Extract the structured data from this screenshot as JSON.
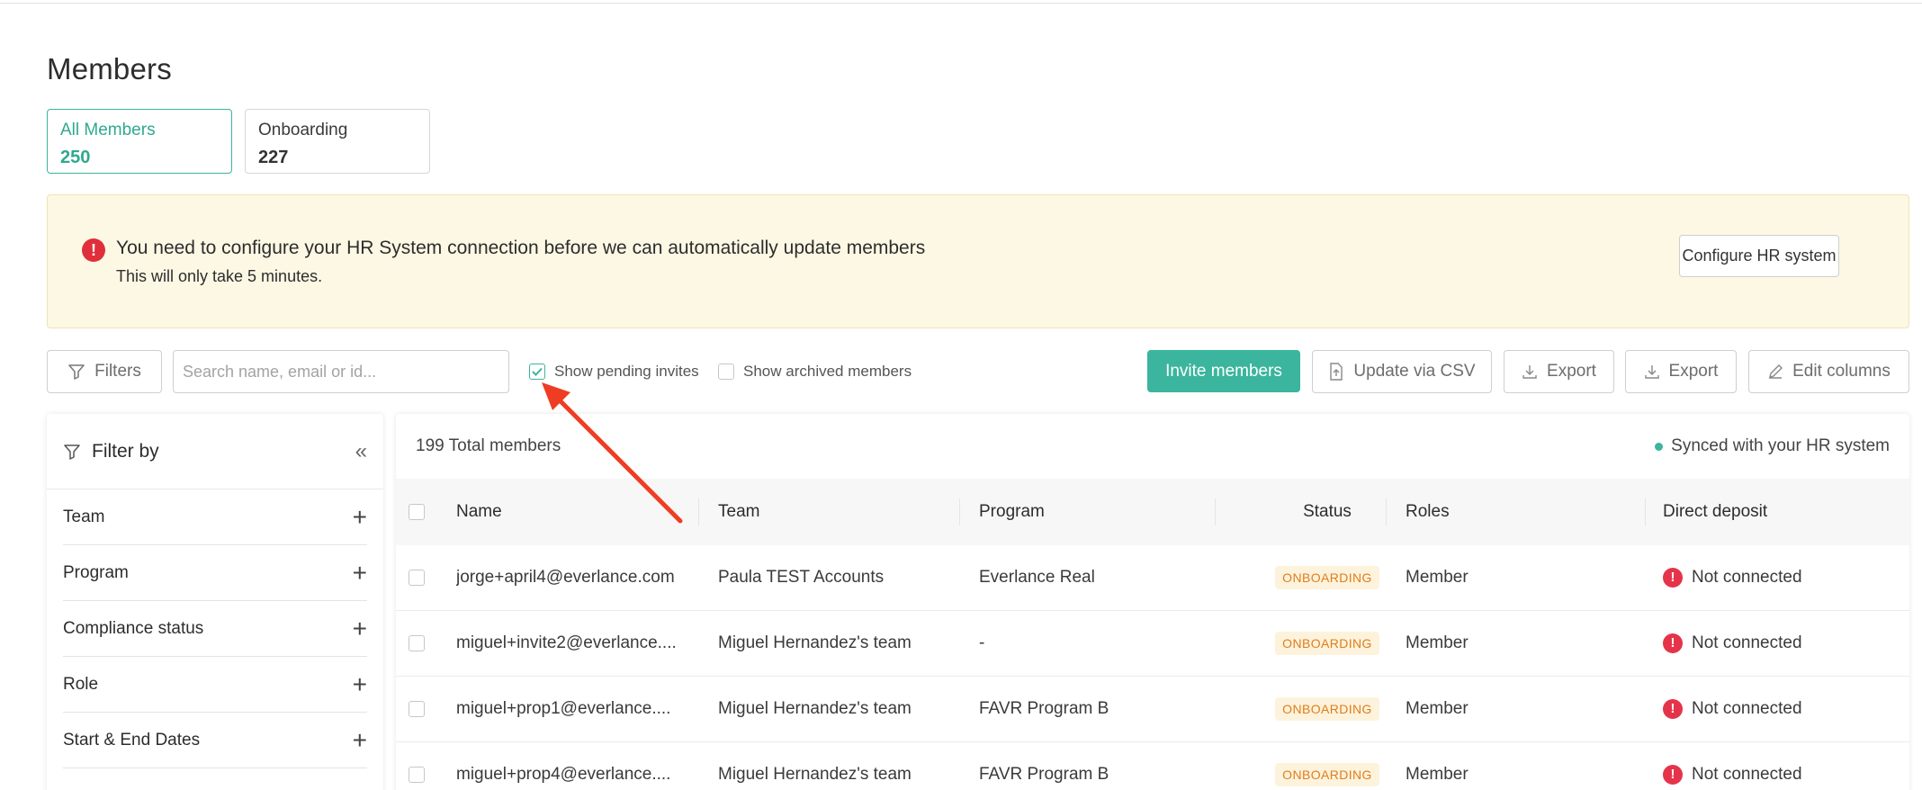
{
  "page": {
    "title": "Members"
  },
  "stats": [
    {
      "label": "All Members",
      "count": "250",
      "active": true
    },
    {
      "label": "Onboarding",
      "count": "227",
      "active": false
    }
  ],
  "alert": {
    "icon": "alert-icon",
    "title": "You need to configure your HR System connection before we can automatically update members",
    "subtitle": "This will only take 5 minutes.",
    "button": "Configure HR system"
  },
  "toolbar": {
    "filters_label": "Filters",
    "search_placeholder": "Search name, email or id...",
    "search_value": "",
    "show_pending_label": "Show pending invites",
    "show_pending_checked": true,
    "show_archived_label": "Show archived members",
    "show_archived_checked": false,
    "invite_label": "Invite members",
    "csv_label": "Update via CSV",
    "export1_label": "Export",
    "export2_label": "Export",
    "edit_columns_label": "Edit columns"
  },
  "filter_panel": {
    "title": "Filter by",
    "items": [
      "Team",
      "Program",
      "Compliance status",
      "Role",
      "Start & End Dates"
    ]
  },
  "table": {
    "total_label": "199 Total members",
    "sync_label": "Synced with your HR system",
    "columns": [
      "Name",
      "Team",
      "Program",
      "Status",
      "Roles",
      "Direct deposit"
    ],
    "rows": [
      {
        "name": "jorge+april4@everlance.com",
        "team": "Paula TEST Accounts",
        "program": "Everlance Real",
        "status": "ONBOARDING",
        "role": "Member",
        "deposit": "Not connected"
      },
      {
        "name": "miguel+invite2@everlance....",
        "team": "Miguel Hernandez's team",
        "program": "-",
        "status": "ONBOARDING",
        "role": "Member",
        "deposit": "Not connected"
      },
      {
        "name": "miguel+prop1@everlance....",
        "team": "Miguel Hernandez's team",
        "program": "FAVR Program B",
        "status": "ONBOARDING",
        "role": "Member",
        "deposit": "Not connected"
      },
      {
        "name": "miguel+prop4@everlance....",
        "team": "Miguel Hernandez's team",
        "program": "FAVR Program B",
        "status": "ONBOARDING",
        "role": "Member",
        "deposit": "Not connected"
      }
    ]
  },
  "colors": {
    "accent": "#3bb59d",
    "alert_bg": "#fdf8e4",
    "error": "#e5344a",
    "badge_text": "#e07d1b",
    "arrow": "#ee3d23"
  }
}
